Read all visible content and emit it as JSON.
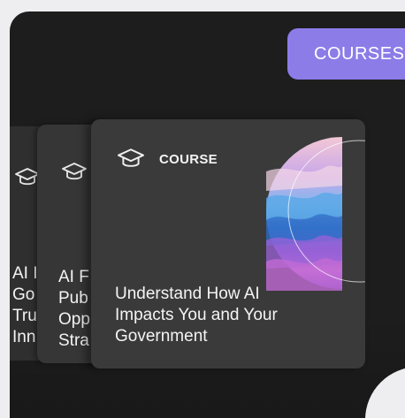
{
  "header": {
    "courses_button_label": "COURSES"
  },
  "cards": {
    "back2": {
      "title_lines": [
        "AI I",
        "Go",
        "Tru",
        "Inn"
      ]
    },
    "back1": {
      "title_lines": [
        "AI F",
        "Pub",
        "Opp",
        "Stra"
      ]
    },
    "front": {
      "tag": "COURSE",
      "title_lines": [
        "Understand How AI",
        "Impacts You and Your",
        "Government"
      ]
    }
  },
  "icons": {
    "course": "graduation-cap-icon",
    "artwork": "abstract-landscape-orb"
  },
  "colors": {
    "panel": "#1d1d1d",
    "accent": "#8c7ce8",
    "card": "#3a3a3a",
    "page": "#eeeef0"
  }
}
